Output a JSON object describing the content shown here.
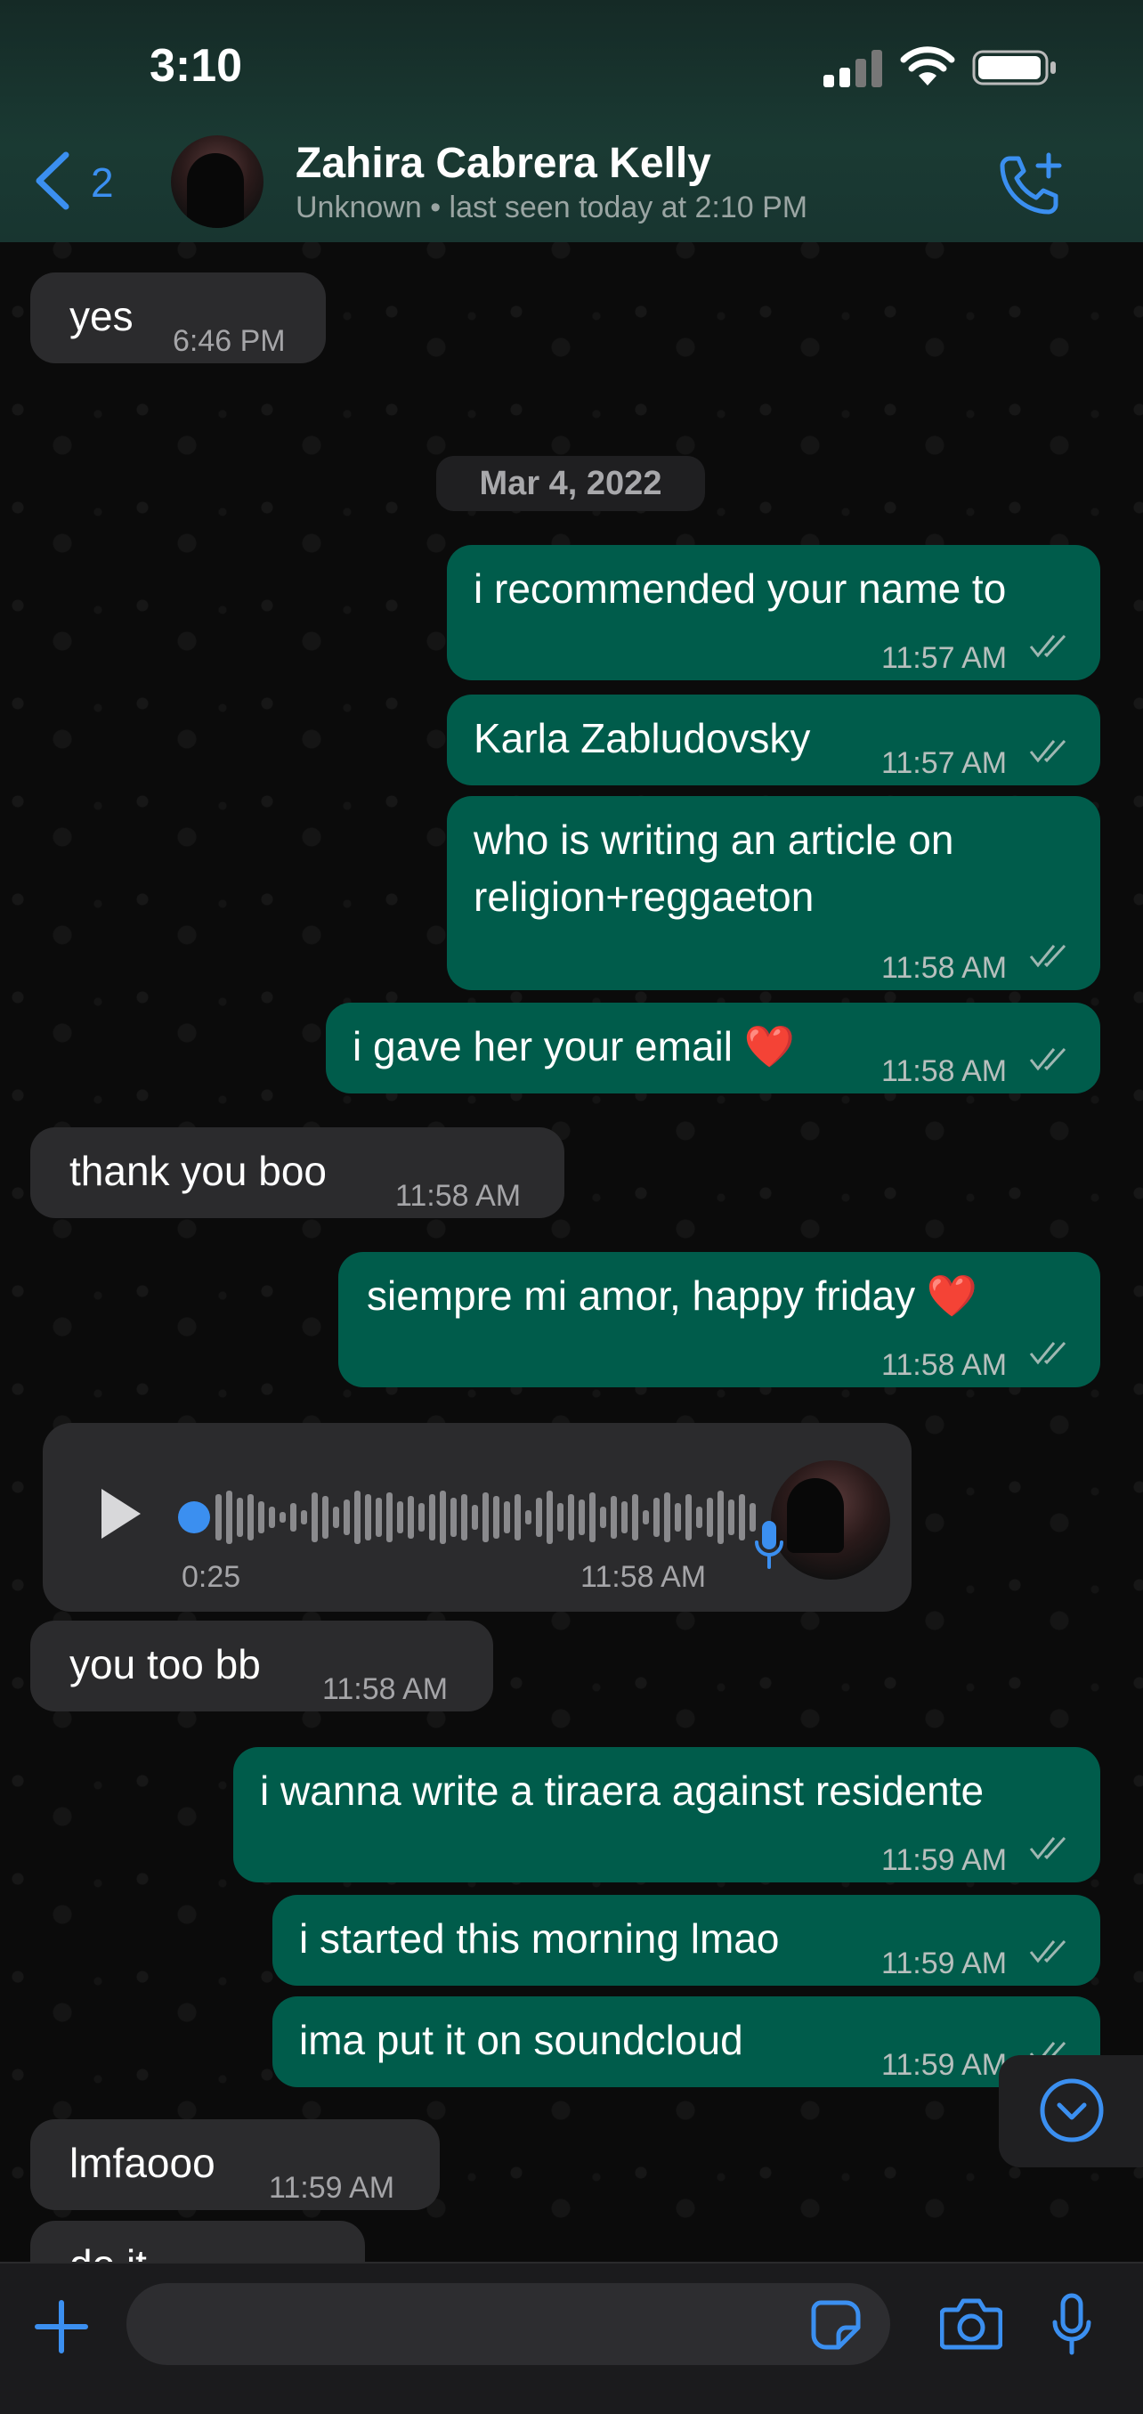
{
  "status_bar": {
    "time": "3:10"
  },
  "header": {
    "back_count": "2",
    "contact_name": "Zahira Cabrera Kelly",
    "subtitle": "Unknown  • last seen today at 2:10 PM"
  },
  "accent_color": "#3b8ff0",
  "bubble_colors": {
    "incoming": "#2b2b2d",
    "outgoing": "#005c4b"
  },
  "messages": [
    {
      "dir": "in",
      "text": "yes",
      "time": "6:46 PM"
    },
    {
      "date_chip": "Mar 4, 2022"
    },
    {
      "dir": "out",
      "text": "i recommended your name to",
      "time": "11:57 AM"
    },
    {
      "dir": "out",
      "text": "Karla Zabludovsky",
      "time": "11:57 AM"
    },
    {
      "dir": "out",
      "text_line1": "who is writing an article on",
      "text_line2": "religion+reggaeton",
      "time": "11:58 AM"
    },
    {
      "dir": "out",
      "text": "i gave her your email ❤️",
      "time": "11:58 AM"
    },
    {
      "dir": "in",
      "text": "thank you boo",
      "time": "11:58 AM"
    },
    {
      "dir": "out",
      "text": "siempre mi amor, happy friday ❤️",
      "time": "11:58 AM"
    },
    {
      "dir": "in",
      "type": "voice",
      "duration": "0:25",
      "time": "11:58 AM"
    },
    {
      "dir": "in",
      "text": "you too bb",
      "time": "11:58 AM"
    },
    {
      "dir": "out",
      "text": "i wanna write a tiraera against residente",
      "time": "11:59 AM"
    },
    {
      "dir": "out",
      "text": "i started this morning lmao",
      "time": "11:59 AM"
    },
    {
      "dir": "out",
      "text": "ima put it on soundcloud",
      "time": "11:59 AM"
    },
    {
      "dir": "in",
      "text": "lmfaooo",
      "time": "11:59 AM"
    },
    {
      "dir": "in",
      "text": "do it",
      "time": ""
    }
  ],
  "composer": {
    "placeholder": ""
  }
}
